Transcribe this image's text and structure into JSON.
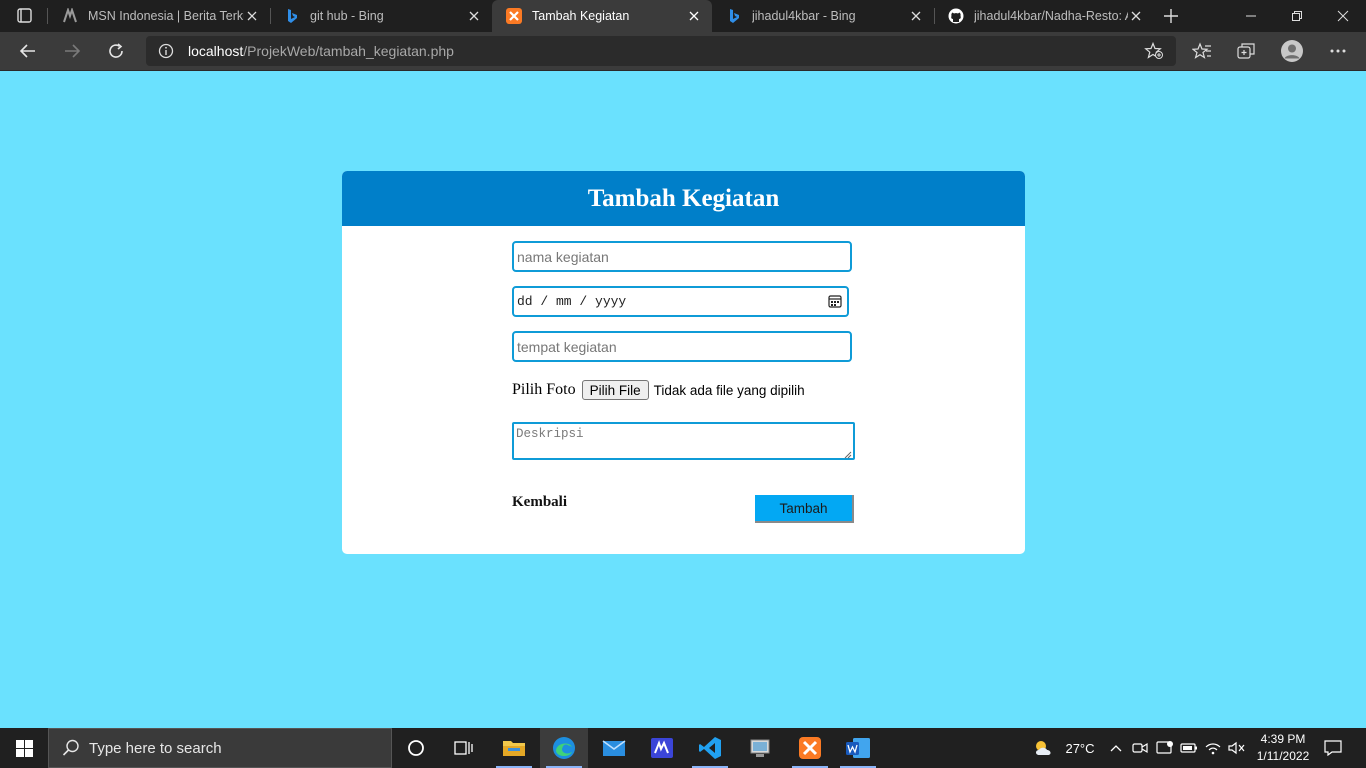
{
  "browser": {
    "tabs": [
      {
        "title": "MSN Indonesia | Berita Terkini",
        "icon": "msn-icon",
        "active": false
      },
      {
        "title": "git hub - Bing",
        "icon": "bing-icon",
        "active": false
      },
      {
        "title": "Tambah Kegiatan",
        "icon": "xampp-icon",
        "active": true
      },
      {
        "title": "jihadul4kbar - Bing",
        "icon": "bing-icon",
        "active": false
      },
      {
        "title": "jihadul4kbar/Nadha-Resto: Ap",
        "icon": "github-icon",
        "active": false
      }
    ],
    "url_host": "localhost",
    "url_path": "/ProjekWeb/tambah_kegiatan.php"
  },
  "form": {
    "title": "Tambah Kegiatan",
    "nama_placeholder": "nama kegiatan",
    "tanggal_placeholder": "dd / mm / yyyy",
    "tempat_placeholder": "tempat kegiatan",
    "foto_label": "Pilih Foto",
    "file_button": "Pilih File",
    "file_status": "Tidak ada file yang dipilih",
    "deskripsi_placeholder": "Deskripsi",
    "back_link": "Kembali",
    "submit_label": "Tambah"
  },
  "taskbar": {
    "search_placeholder": "Type here to search",
    "temperature": "27°C",
    "time": "4:39 PM",
    "date": "1/11/2022"
  },
  "colors": {
    "page_background": "#6ae1fe",
    "header_background": "#007fc9",
    "input_border": "#0f9bd7",
    "submit_background": "#03a8f3"
  }
}
